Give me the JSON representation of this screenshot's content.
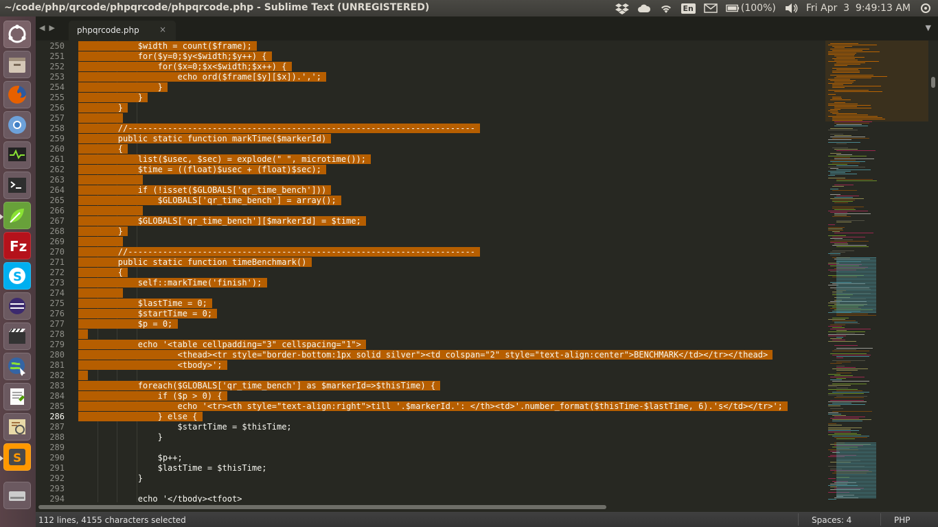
{
  "window": {
    "title": "~/code/php/qrcode/phpqrcode/phpqrcode.php - Sublime Text (UNREGISTERED)"
  },
  "tray": {
    "battery": "(100%)",
    "clock": "Fri Apr  3  9:49:13 AM",
    "keyboard": "En"
  },
  "tab": {
    "label": "phpqrcode.php",
    "close": "×"
  },
  "editor": {
    "lines": [
      {
        "n": "250",
        "text": "            $width = count($frame);",
        "sel": true
      },
      {
        "n": "251",
        "text": "            for($y=0;$y<$width;$y++) {",
        "sel": true
      },
      {
        "n": "252",
        "text": "                for($x=0;$x<$width;$x++) {",
        "sel": true
      },
      {
        "n": "253",
        "text": "                    echo ord($frame[$y][$x]).',';",
        "sel": true
      },
      {
        "n": "254",
        "text": "                }",
        "sel": true
      },
      {
        "n": "255",
        "text": "            }",
        "sel": true
      },
      {
        "n": "256",
        "text": "        }",
        "sel": true
      },
      {
        "n": "257",
        "text": "        ",
        "sel": true
      },
      {
        "n": "258",
        "text": "        //----------------------------------------------------------------------",
        "sel": true
      },
      {
        "n": "259",
        "text": "        public static function markTime($markerId)",
        "sel": true
      },
      {
        "n": "260",
        "text": "        {",
        "sel": true
      },
      {
        "n": "261",
        "text": "            list($usec, $sec) = explode(\" \", microtime());",
        "sel": true
      },
      {
        "n": "262",
        "text": "            $time = ((float)$usec + (float)$sec);",
        "sel": true
      },
      {
        "n": "263",
        "text": "            ",
        "sel": true
      },
      {
        "n": "264",
        "text": "            if (!isset($GLOBALS['qr_time_bench']))",
        "sel": true
      },
      {
        "n": "265",
        "text": "                $GLOBALS['qr_time_bench'] = array();",
        "sel": true
      },
      {
        "n": "266",
        "text": "            ",
        "sel": true
      },
      {
        "n": "267",
        "text": "            $GLOBALS['qr_time_bench'][$markerId] = $time;",
        "sel": true
      },
      {
        "n": "268",
        "text": "        }",
        "sel": true
      },
      {
        "n": "269",
        "text": "        ",
        "sel": true
      },
      {
        "n": "270",
        "text": "        //----------------------------------------------------------------------",
        "sel": true
      },
      {
        "n": "271",
        "text": "        public static function timeBenchmark()",
        "sel": true
      },
      {
        "n": "272",
        "text": "        {",
        "sel": true
      },
      {
        "n": "273",
        "text": "            self::markTime('finish');",
        "sel": true
      },
      {
        "n": "274",
        "text": "        ",
        "sel": true
      },
      {
        "n": "275",
        "text": "            $lastTime = 0;",
        "sel": true
      },
      {
        "n": "276",
        "text": "            $startTime = 0;",
        "sel": true
      },
      {
        "n": "277",
        "text": "            $p = 0;",
        "sel": true
      },
      {
        "n": "278",
        "text": "",
        "sel": true
      },
      {
        "n": "279",
        "text": "            echo '<table cellpadding=\"3\" cellspacing=\"1\">",
        "sel": true
      },
      {
        "n": "280",
        "text": "                    <thead><tr style=\"border-bottom:1px solid silver\"><td colspan=\"2\" style=\"text-align:center\">BENCHMARK</td></tr></thead>",
        "sel": true
      },
      {
        "n": "281",
        "text": "                    <tbody>';",
        "sel": true
      },
      {
        "n": "282",
        "text": "",
        "sel": true
      },
      {
        "n": "283",
        "text": "            foreach($GLOBALS['qr_time_bench'] as $markerId=>$thisTime) {",
        "sel": true
      },
      {
        "n": "284",
        "text": "                if ($p > 0) {",
        "sel": true
      },
      {
        "n": "285",
        "text": "                    echo '<tr><th style=\"text-align:right\">till '.$markerId.': </th><td>'.number_format($thisTime-$lastTime, 6).'s</td></tr>';",
        "sel": true
      },
      {
        "n": "286",
        "text": "                } else {",
        "sel": true
      },
      {
        "n": "287",
        "text": "                    $startTime = $thisTime;",
        "sel": false
      },
      {
        "n": "288",
        "text": "                }",
        "sel": false
      },
      {
        "n": "289",
        "text": "",
        "sel": false
      },
      {
        "n": "290",
        "text": "                $p++;",
        "sel": false
      },
      {
        "n": "291",
        "text": "                $lastTime = $thisTime;",
        "sel": false
      },
      {
        "n": "292",
        "text": "            }",
        "sel": false
      },
      {
        "n": "293",
        "text": "",
        "sel": false
      },
      {
        "n": "294",
        "text": "            echo '</tbody><tfoot>",
        "sel": false
      }
    ]
  },
  "statusbar": {
    "selection": "112 lines, 4155 characters selected",
    "spaces": "Spaces: 4",
    "syntax": "PHP"
  },
  "colors": {
    "selection": "#b65e00",
    "editor_bg": "#272822",
    "keyword": "#f92672",
    "string": "#e6db74"
  },
  "launcher": {
    "items": [
      "ubuntu-dash-icon",
      "files-icon",
      "firefox-icon",
      "chromium-icon",
      "system-monitor-icon",
      "terminal-icon",
      "leaf-editor-icon",
      "filezilla-icon",
      "skype-icon",
      "eclipse-icon",
      "video-editor-icon",
      "network-browser-icon",
      "text-editor-icon",
      "image-viewer-icon",
      "sublime-text-icon",
      "drive-icon"
    ]
  }
}
